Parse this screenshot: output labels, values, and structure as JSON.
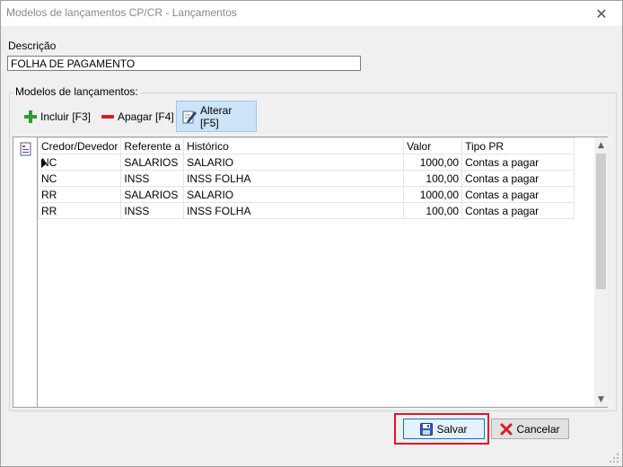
{
  "window": {
    "title": "Modelos de lançamentos CP/CR - Lançamentos",
    "close_glyph": "✕"
  },
  "form": {
    "descricao_label": "Descrição",
    "descricao_value": "FOLHA DE PAGAMENTO",
    "group_label": "Modelos de lançamentos:"
  },
  "toolbar": {
    "incluir_label": "Incluir [F3]",
    "apagar_label": "Apagar [F4]",
    "alterar_label": "Alterar [F5]"
  },
  "grid": {
    "columns": [
      "Credor/Devedor",
      "Referente a",
      "Histórico",
      "Valor",
      "Tipo PR"
    ],
    "rows": [
      [
        "NC",
        "SALARIOS",
        "SALARIO",
        "1000,00",
        "Contas a pagar"
      ],
      [
        "NC",
        "INSS",
        "INSS FOLHA",
        "100,00",
        "Contas a pagar"
      ],
      [
        "RR",
        "SALARIOS",
        "SALARIO",
        "1000,00",
        "Contas a pagar"
      ],
      [
        "RR",
        "INSS",
        "INSS FOLHA",
        "100,00",
        "Contas a pagar"
      ]
    ],
    "selected_row": 0,
    "scroll_up_glyph": "▲",
    "scroll_down_glyph": "▼"
  },
  "buttons": {
    "salvar_label": "Salvar",
    "cancelar_label": "Cancelar"
  },
  "icons": {
    "incluir": "plus-icon",
    "apagar": "minus-icon",
    "alterar": "edit-icon",
    "salvar": "floppy-disk-icon",
    "cancelar": "red-x-icon",
    "grid": "document-icon"
  },
  "colors": {
    "plus": "#2e9e2e",
    "minus": "#d81e1e",
    "highlight": "#e81123",
    "floppy": "#2d5db8",
    "toolbar_active": "#cce4f7"
  }
}
